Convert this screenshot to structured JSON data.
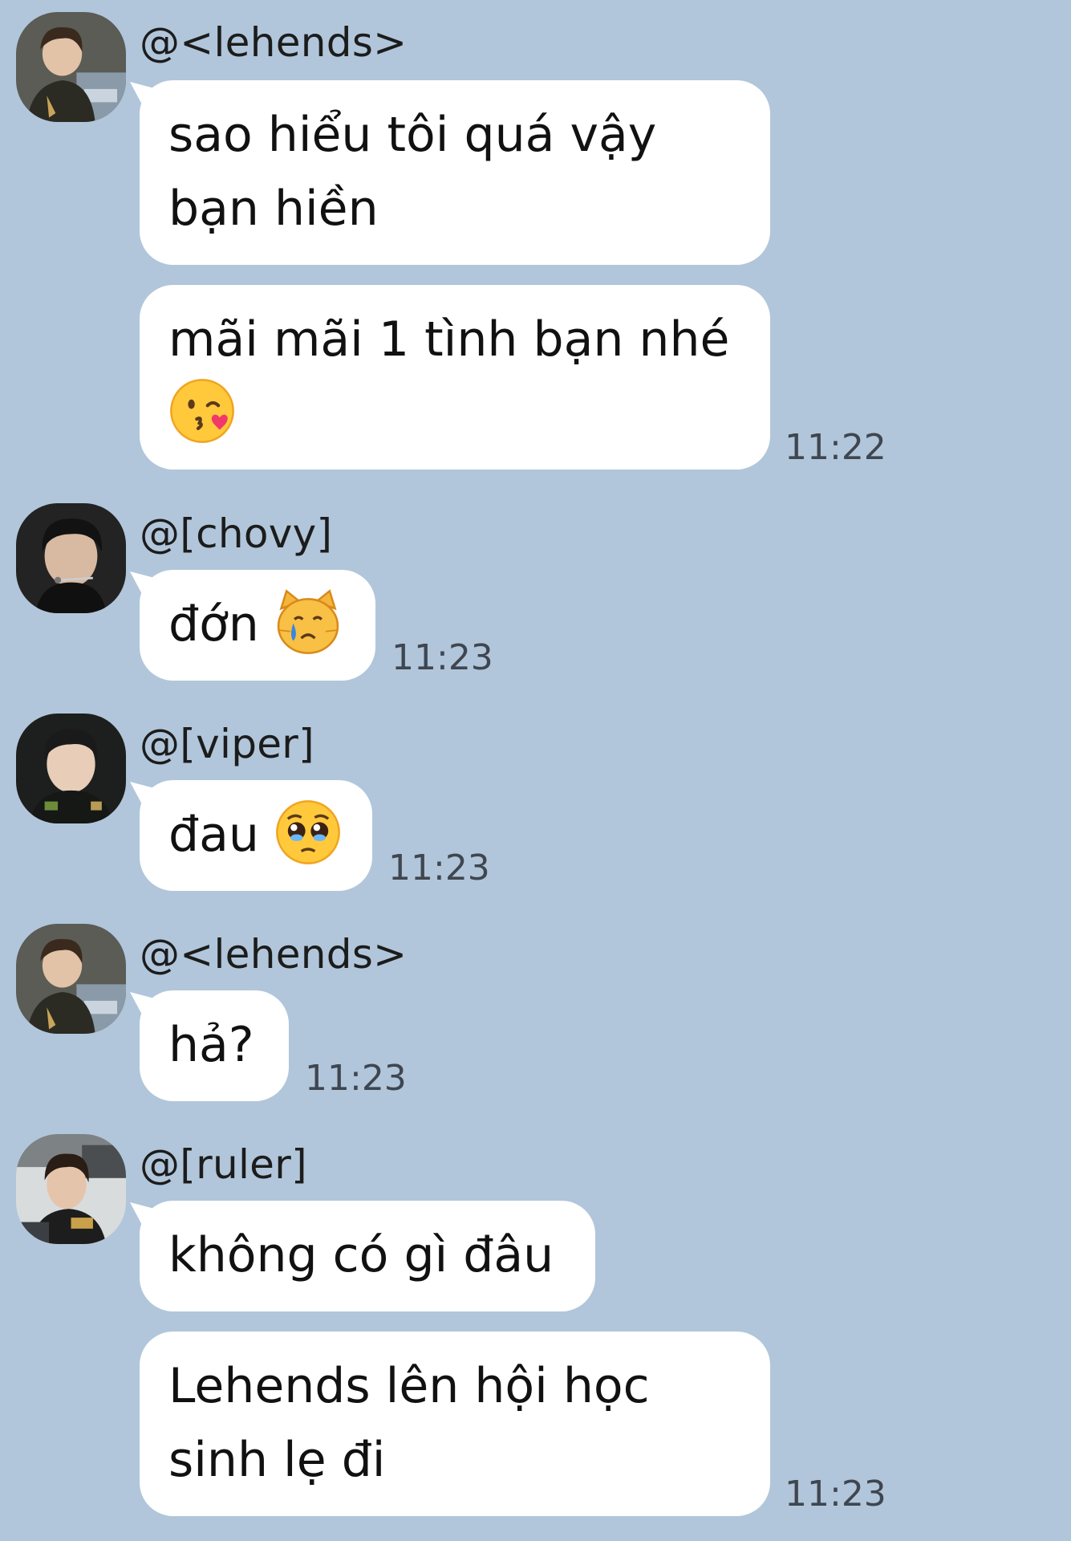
{
  "messages": [
    {
      "sender": "@<lehends>",
      "bubbles": [
        {
          "lines": [
            "sao hiểu tôi quá vậy",
            "bạn hiền"
          ]
        },
        {
          "lines": [
            "mãi mãi 1 tình bạn nhé"
          ],
          "emoji": "kissing-face-icon"
        }
      ],
      "time": "11:22"
    },
    {
      "sender": "@[chovy]",
      "bubbles": [
        {
          "lines": [
            "đớn"
          ],
          "emoji": "crying-cat-icon"
        }
      ],
      "time": "11:23"
    },
    {
      "sender": "@[viper]",
      "bubbles": [
        {
          "lines": [
            "đau"
          ],
          "emoji": "pleading-face-icon"
        }
      ],
      "time": "11:23"
    },
    {
      "sender": "@<lehends>",
      "bubbles": [
        {
          "lines": [
            "hả?"
          ]
        }
      ],
      "time": "11:23"
    },
    {
      "sender": "@[ruler]",
      "bubbles": [
        {
          "lines": [
            "không có gì đâu"
          ]
        },
        {
          "lines": [
            "Lehends lên hội học",
            "sinh lẹ đi"
          ]
        }
      ],
      "time": "11:23"
    }
  ],
  "colors": {
    "background": "#b1c6da",
    "bubble": "#ffffff",
    "text": "#111111",
    "time": "#3f4650"
  }
}
